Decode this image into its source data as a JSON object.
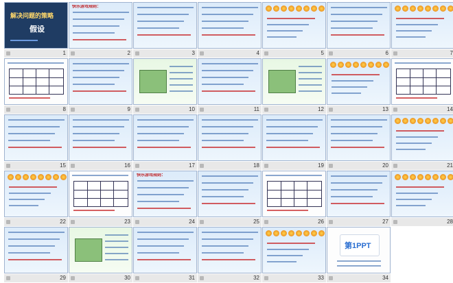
{
  "view": "slide-sorter",
  "slides": [
    {
      "n": "1",
      "kind": "title",
      "title": "解决问题的策略",
      "subtitle": "假设"
    },
    {
      "n": "2",
      "kind": "text",
      "heading": "快乐游戏规则："
    },
    {
      "n": "3",
      "kind": "text",
      "heading": ""
    },
    {
      "n": "4",
      "kind": "text",
      "heading": ""
    },
    {
      "n": "5",
      "kind": "medals",
      "heading": ""
    },
    {
      "n": "6",
      "kind": "text",
      "heading": ""
    },
    {
      "n": "7",
      "kind": "medals",
      "heading": ""
    },
    {
      "n": "8",
      "kind": "table",
      "heading": ""
    },
    {
      "n": "9",
      "kind": "text",
      "heading": ""
    },
    {
      "n": "10",
      "kind": "picture",
      "heading": ""
    },
    {
      "n": "11",
      "kind": "text",
      "heading": ""
    },
    {
      "n": "12",
      "kind": "picture",
      "heading": ""
    },
    {
      "n": "13",
      "kind": "medals",
      "heading": ""
    },
    {
      "n": "14",
      "kind": "table",
      "heading": ""
    },
    {
      "n": "15",
      "kind": "text",
      "heading": ""
    },
    {
      "n": "16",
      "kind": "text",
      "heading": ""
    },
    {
      "n": "17",
      "kind": "text",
      "heading": ""
    },
    {
      "n": "18",
      "kind": "text",
      "heading": ""
    },
    {
      "n": "19",
      "kind": "text",
      "heading": ""
    },
    {
      "n": "20",
      "kind": "text",
      "heading": ""
    },
    {
      "n": "21",
      "kind": "medals",
      "heading": ""
    },
    {
      "n": "22",
      "kind": "medals",
      "heading": ""
    },
    {
      "n": "23",
      "kind": "table",
      "heading": ""
    },
    {
      "n": "24",
      "kind": "text",
      "heading": "快乐游戏规则："
    },
    {
      "n": "25",
      "kind": "text",
      "heading": ""
    },
    {
      "n": "26",
      "kind": "table",
      "heading": ""
    },
    {
      "n": "27",
      "kind": "text",
      "heading": ""
    },
    {
      "n": "28",
      "kind": "medals",
      "heading": ""
    },
    {
      "n": "29",
      "kind": "text",
      "heading": ""
    },
    {
      "n": "30",
      "kind": "picture",
      "heading": ""
    },
    {
      "n": "31",
      "kind": "text",
      "heading": ""
    },
    {
      "n": "32",
      "kind": "text",
      "heading": ""
    },
    {
      "n": "33",
      "kind": "medals",
      "heading": ""
    },
    {
      "n": "34",
      "kind": "logo",
      "heading": "",
      "logo_text": "第1PPT"
    }
  ],
  "colors": {
    "slide_border": "#9fb3cf",
    "caption_bg": "#e8e8e8",
    "title_slide_bg": "#1f3c63"
  }
}
